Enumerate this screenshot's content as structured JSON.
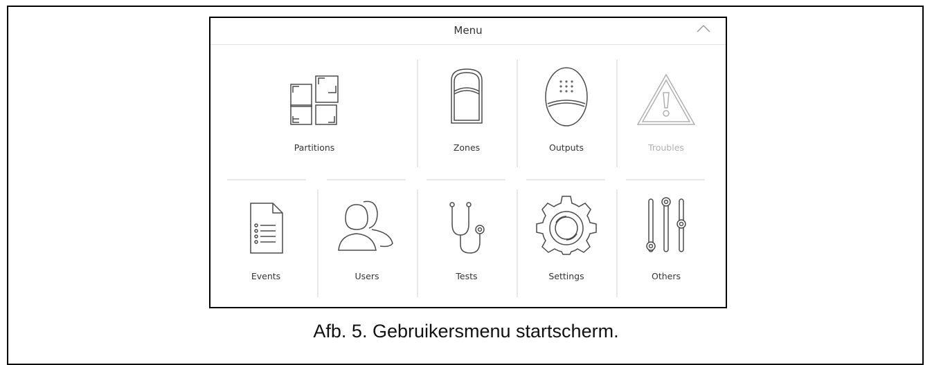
{
  "header": {
    "title": "Menu",
    "collapse_icon": "chevron-up-icon"
  },
  "tiles": {
    "partitions": {
      "label": "Partitions",
      "icon": "partitions-icon"
    },
    "zones": {
      "label": "Zones",
      "icon": "zones-icon"
    },
    "outputs": {
      "label": "Outputs",
      "icon": "outputs-icon"
    },
    "troubles": {
      "label": "Troubles",
      "icon": "warning-icon",
      "state": "disabled"
    },
    "events": {
      "label": "Events",
      "icon": "document-icon"
    },
    "users": {
      "label": "Users",
      "icon": "users-icon"
    },
    "tests": {
      "label": "Tests",
      "icon": "stethoscope-icon"
    },
    "settings": {
      "label": "Settings",
      "icon": "gear-icon"
    },
    "others": {
      "label": "Others",
      "icon": "sliders-icon"
    }
  },
  "colors": {
    "icon_stroke": "#4a4a4a",
    "disabled": "#b0b0b0",
    "divider": "#e8e8e8"
  },
  "caption": "Afb. 5. Gebruikersmenu startscherm."
}
